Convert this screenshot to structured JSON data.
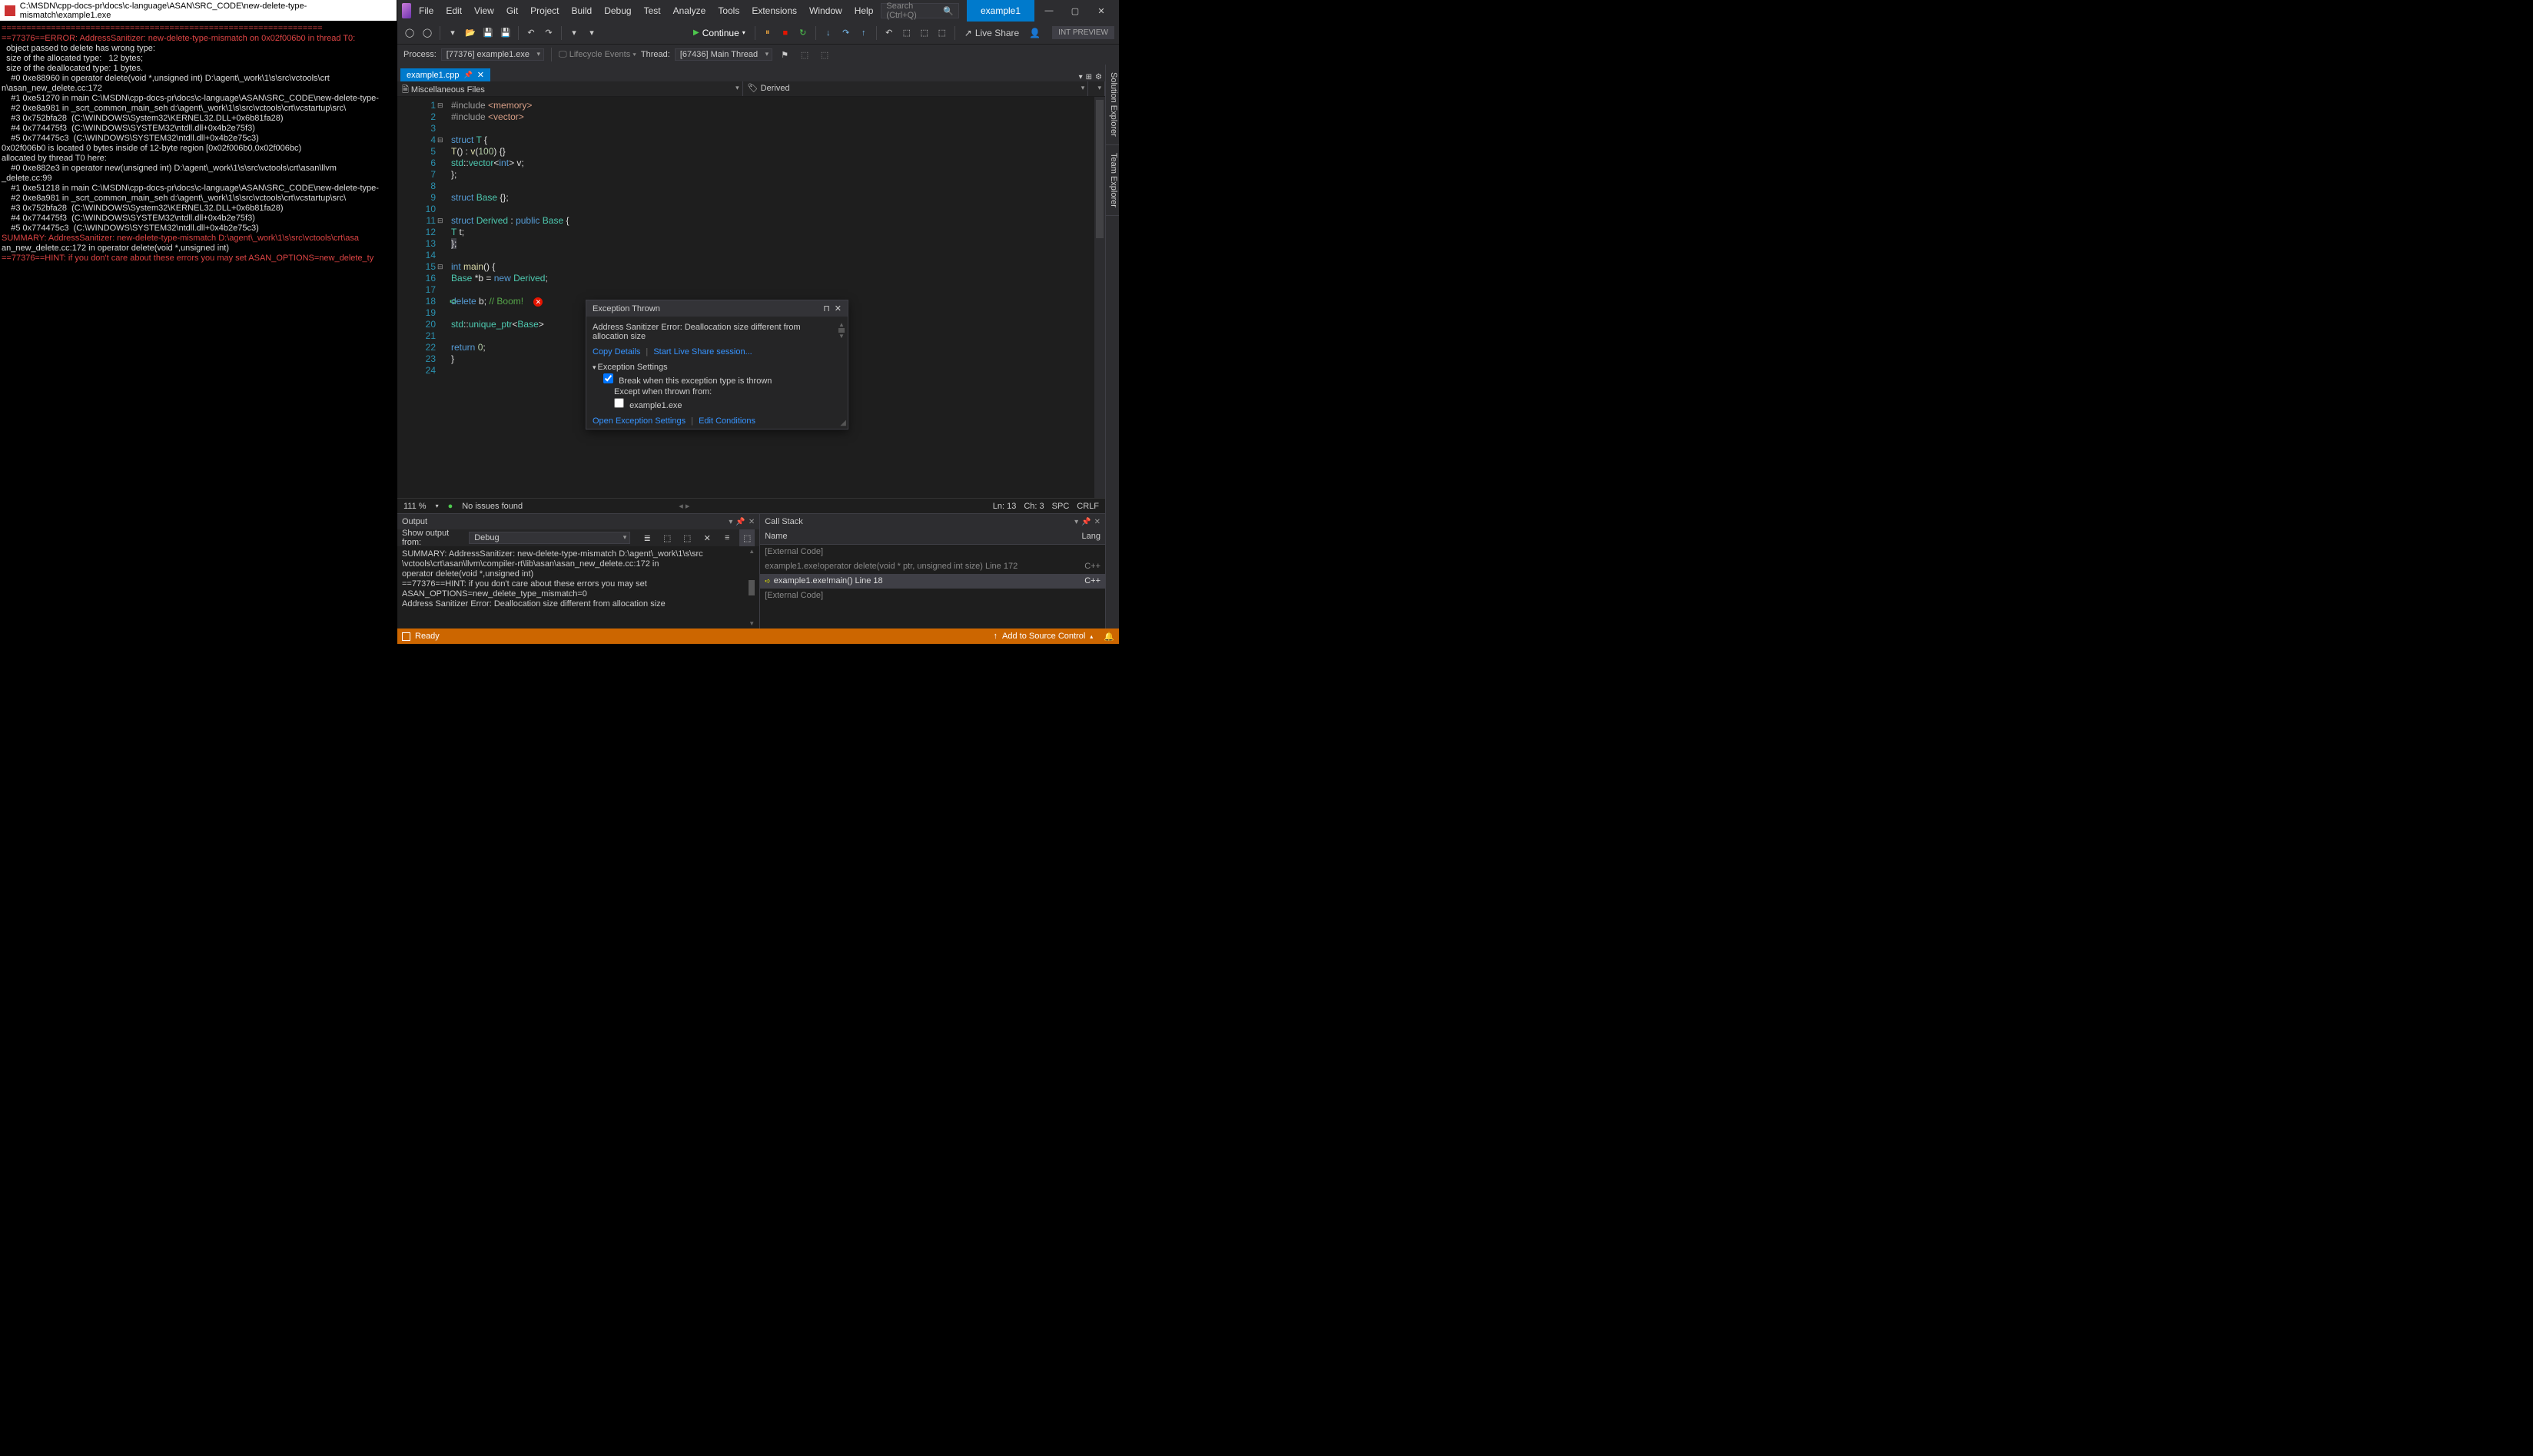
{
  "console": {
    "title": "C:\\MSDN\\cpp-docs-pr\\docs\\c-language\\ASAN\\SRC_CODE\\new-delete-type-mismatch\\example1.exe",
    "lines": [
      "=================================================================",
      "==77376==ERROR: AddressSanitizer: new-delete-type-mismatch on 0x02f006b0 in thread T0:",
      "  object passed to delete has wrong type:",
      "  size of the allocated type:   12 bytes;",
      "  size of the deallocated type: 1 bytes.",
      "    #0 0xe88960 in operator delete(void *,unsigned int) D:\\agent\\_work\\1\\s\\src\\vctools\\crt",
      "n\\asan_new_delete.cc:172",
      "    #1 0xe51270 in main C:\\MSDN\\cpp-docs-pr\\docs\\c-language\\ASAN\\SRC_CODE\\new-delete-type-",
      "    #2 0xe8a981 in _scrt_common_main_seh d:\\agent\\_work\\1\\s\\src\\vctools\\crt\\vcstartup\\src\\",
      "    #3 0x752bfa28  (C:\\WINDOWS\\System32\\KERNEL32.DLL+0x6b81fa28)",
      "    #4 0x774475f3  (C:\\WINDOWS\\SYSTEM32\\ntdll.dll+0x4b2e75f3)",
      "    #5 0x774475c3  (C:\\WINDOWS\\SYSTEM32\\ntdll.dll+0x4b2e75c3)",
      "",
      "0x02f006b0 is located 0 bytes inside of 12-byte region [0x02f006b0,0x02f006bc)",
      "allocated by thread T0 here:",
      "    #0 0xe882e3 in operator new(unsigned int) D:\\agent\\_work\\1\\s\\src\\vctools\\crt\\asan\\llvm",
      "_delete.cc:99",
      "    #1 0xe51218 in main C:\\MSDN\\cpp-docs-pr\\docs\\c-language\\ASAN\\SRC_CODE\\new-delete-type-",
      "    #2 0xe8a981 in _scrt_common_main_seh d:\\agent\\_work\\1\\s\\src\\vctools\\crt\\vcstartup\\src\\",
      "    #3 0x752bfa28  (C:\\WINDOWS\\System32\\KERNEL32.DLL+0x6b81fa28)",
      "    #4 0x774475f3  (C:\\WINDOWS\\SYSTEM32\\ntdll.dll+0x4b2e75f3)",
      "    #5 0x774475c3  (C:\\WINDOWS\\SYSTEM32\\ntdll.dll+0x4b2e75c3)",
      "",
      "SUMMARY: AddressSanitizer: new-delete-type-mismatch D:\\agent\\_work\\1\\s\\src\\vctools\\crt\\asa",
      "an_new_delete.cc:172 in operator delete(void *,unsigned int)",
      "==77376==HINT: if you don't care about these errors you may set ASAN_OPTIONS=new_delete_ty"
    ]
  },
  "menu": [
    "File",
    "Edit",
    "View",
    "Git",
    "Project",
    "Build",
    "Debug",
    "Test",
    "Analyze",
    "Tools",
    "Extensions",
    "Window",
    "Help"
  ],
  "search_placeholder": "Search (Ctrl+Q)",
  "solution_name": "example1",
  "continue_label": "Continue",
  "liveshare_label": "Live Share",
  "intpreview_label": "INT PREVIEW",
  "process": {
    "label": "Process:",
    "value": "[77376] example1.exe"
  },
  "lifecycle": "Lifecycle Events",
  "thread": {
    "label": "Thread:",
    "value": "[67436] Main Thread"
  },
  "tab": {
    "name": "example1.cpp"
  },
  "nav": {
    "left": "Miscellaneous Files",
    "right": "Derived"
  },
  "side_tabs": [
    "Solution Explorer",
    "Team Explorer"
  ],
  "code_zoom": "111 %",
  "issues": "No issues found",
  "caret": {
    "ln": "Ln: 13",
    "ch": "Ch: 3",
    "spc": "SPC",
    "crlf": "CRLF"
  },
  "exception": {
    "title": "Exception Thrown",
    "message": "Address Sanitizer Error: Deallocation size different from allocation size",
    "copy": "Copy Details",
    "liveshare": "Start Live Share session...",
    "settings_label": "Exception Settings",
    "break_label": "Break when this exception type is thrown",
    "except_label": "Except when thrown from:",
    "module": "example1.exe",
    "open_settings": "Open Exception Settings",
    "edit_cond": "Edit Conditions"
  },
  "output": {
    "title": "Output",
    "show_from": "Show output from:",
    "source": "Debug",
    "lines": [
      "SUMMARY: AddressSanitizer: new-delete-type-mismatch D:\\agent\\_work\\1\\s\\src",
      "    \\vctools\\crt\\asan\\llvm\\compiler-rt\\lib\\asan\\asan_new_delete.cc:172 in",
      "    operator delete(void *,unsigned int)",
      "==77376==HINT: if you don't care about these errors you may set",
      "    ASAN_OPTIONS=new_delete_type_mismatch=0",
      "Address Sanitizer Error: Deallocation size different from allocation size"
    ]
  },
  "callstack": {
    "title": "Call Stack",
    "col_name": "Name",
    "col_lang": "Lang",
    "rows": [
      {
        "name": "[External Code]",
        "lang": "",
        "ext": true
      },
      {
        "name": "example1.exe!operator delete(void * ptr, unsigned int size) Line 172",
        "lang": "C++"
      },
      {
        "name": "example1.exe!main() Line 18",
        "lang": "C++",
        "active": true
      },
      {
        "name": "[External Code]",
        "lang": "",
        "ext": true
      }
    ]
  },
  "status": {
    "ready": "Ready",
    "add": "Add to Source Control"
  }
}
